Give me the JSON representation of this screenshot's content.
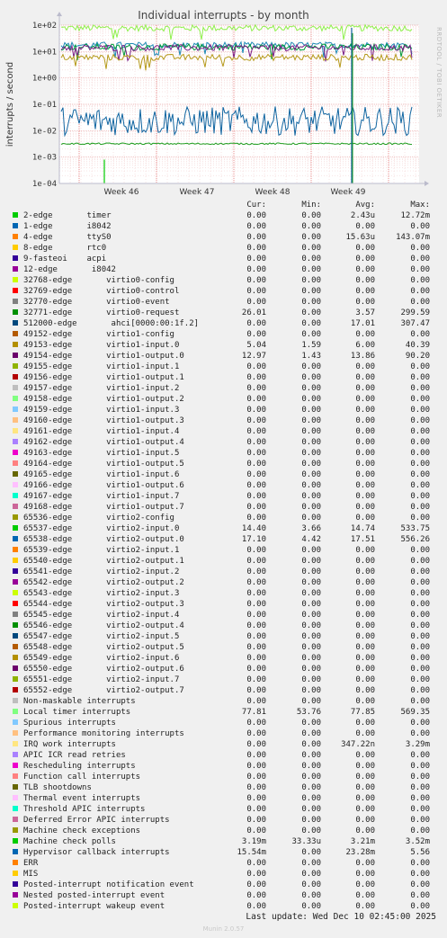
{
  "title": "Individual interrupts - by month",
  "side_label": "RRDTOOL / TOBI OETIKER",
  "footer": "Munin 2.0.57",
  "last_update": "Last update: Wed Dec 10 02:45:00 2025",
  "legend_header": [
    "Cur:",
    "Min:",
    "Avg:",
    "Max:"
  ],
  "chart_data": {
    "type": "line",
    "title": "Individual interrupts - by month",
    "ylabel": "interrupts / second",
    "yscale": "log",
    "ylim": [
      0.0001,
      100
    ],
    "yticks": [
      "1e+02",
      "1e+01",
      "1e+00",
      "1e-01",
      "1e-02",
      "1e-03",
      "1e-04"
    ],
    "x_ticks": [
      "Week 46",
      "Week 47",
      "Week 48",
      "Week 49"
    ],
    "grid": true,
    "legend_placement": "bottom",
    "series": [
      {
        "name": "Local timer interrupts",
        "color": "#8ef04c",
        "level": 77.85
      },
      {
        "name": "65538-edge virtio2-output.0",
        "color": "#1c8ab5",
        "level": 17.51
      },
      {
        "name": "65537-edge virtio2-input.0",
        "color": "#009a3a",
        "level": 14.74
      },
      {
        "name": "49154-edge virtio1-output.0",
        "color": "#7a1f86",
        "level": 13.86
      },
      {
        "name": "49153-edge virtio1-input.0",
        "color": "#b5991a",
        "level": 6.0
      },
      {
        "name": "Hypervisor callback interrupts",
        "color": "#0f64a0",
        "level": 0.0233
      },
      {
        "name": "Machine check polls",
        "color": "#1a9b1a",
        "level": 0.00321
      }
    ],
    "rows": [
      {
        "label": "2-edge       timer",
        "color": "#00cc00",
        "cur": "0.00",
        "min": "0.00",
        "avg": "2.43u",
        "max": "12.72m"
      },
      {
        "label": "1-edge       i8042",
        "color": "#0066b3",
        "cur": "0.00",
        "min": "0.00",
        "avg": "0.00",
        "max": "0.00"
      },
      {
        "label": "4-edge       ttyS0",
        "color": "#ff8000",
        "cur": "0.00",
        "min": "0.00",
        "avg": "15.63u",
        "max": "143.07m"
      },
      {
        "label": "8-edge       rtc0",
        "color": "#ffcc00",
        "cur": "0.00",
        "min": "0.00",
        "avg": "0.00",
        "max": "0.00"
      },
      {
        "label": "9-fasteoi    acpi",
        "color": "#330099",
        "cur": "0.00",
        "min": "0.00",
        "avg": "0.00",
        "max": "0.00"
      },
      {
        "label": "12-edge       i8042",
        "color": "#990099",
        "cur": "0.00",
        "min": "0.00",
        "avg": "0.00",
        "max": "0.00"
      },
      {
        "label": "32768-edge       virtio0-config",
        "color": "#ccff00",
        "cur": "0.00",
        "min": "0.00",
        "avg": "0.00",
        "max": "0.00"
      },
      {
        "label": "32769-edge       virtio0-control",
        "color": "#ff0000",
        "cur": "0.00",
        "min": "0.00",
        "avg": "0.00",
        "max": "0.00"
      },
      {
        "label": "32770-edge       virtio0-event",
        "color": "#808080",
        "cur": "0.00",
        "min": "0.00",
        "avg": "0.00",
        "max": "0.00"
      },
      {
        "label": "32771-edge       virtio0-request",
        "color": "#008f00",
        "cur": "26.01",
        "min": "0.00",
        "avg": "3.57",
        "max": "299.59"
      },
      {
        "label": "512000-edge       ahci[0000:00:1f.2]",
        "color": "#00487d",
        "cur": "0.00",
        "min": "0.00",
        "avg": "17.01",
        "max": "307.47"
      },
      {
        "label": "49152-edge       virtio1-config",
        "color": "#b35a00",
        "cur": "0.00",
        "min": "0.00",
        "avg": "0.00",
        "max": "0.00"
      },
      {
        "label": "49153-edge       virtio1-input.0",
        "color": "#b38f00",
        "cur": "5.04",
        "min": "1.59",
        "avg": "6.00",
        "max": "40.39"
      },
      {
        "label": "49154-edge       virtio1-output.0",
        "color": "#6b006b",
        "cur": "12.97",
        "min": "1.43",
        "avg": "13.86",
        "max": "90.20"
      },
      {
        "label": "49155-edge       virtio1-input.1",
        "color": "#8fb300",
        "cur": "0.00",
        "min": "0.00",
        "avg": "0.00",
        "max": "0.00"
      },
      {
        "label": "49156-edge       virtio1-output.1",
        "color": "#b30000",
        "cur": "0.00",
        "min": "0.00",
        "avg": "0.00",
        "max": "0.00"
      },
      {
        "label": "49157-edge       virtio1-input.2",
        "color": "#bebebe",
        "cur": "0.00",
        "min": "0.00",
        "avg": "0.00",
        "max": "0.00"
      },
      {
        "label": "49158-edge       virtio1-output.2",
        "color": "#80ff80",
        "cur": "0.00",
        "min": "0.00",
        "avg": "0.00",
        "max": "0.00"
      },
      {
        "label": "49159-edge       virtio1-input.3",
        "color": "#80c9ff",
        "cur": "0.00",
        "min": "0.00",
        "avg": "0.00",
        "max": "0.00"
      },
      {
        "label": "49160-edge       virtio1-output.3",
        "color": "#ffc080",
        "cur": "0.00",
        "min": "0.00",
        "avg": "0.00",
        "max": "0.00"
      },
      {
        "label": "49161-edge       virtio1-input.4",
        "color": "#ffe680",
        "cur": "0.00",
        "min": "0.00",
        "avg": "0.00",
        "max": "0.00"
      },
      {
        "label": "49162-edge       virtio1-output.4",
        "color": "#aa80ff",
        "cur": "0.00",
        "min": "0.00",
        "avg": "0.00",
        "max": "0.00"
      },
      {
        "label": "49163-edge       virtio1-input.5",
        "color": "#ee00cc",
        "cur": "0.00",
        "min": "0.00",
        "avg": "0.00",
        "max": "0.00"
      },
      {
        "label": "49164-edge       virtio1-output.5",
        "color": "#ff8080",
        "cur": "0.00",
        "min": "0.00",
        "avg": "0.00",
        "max": "0.00"
      },
      {
        "label": "49165-edge       virtio1-input.6",
        "color": "#666600",
        "cur": "0.00",
        "min": "0.00",
        "avg": "0.00",
        "max": "0.00"
      },
      {
        "label": "49166-edge       virtio1-output.6",
        "color": "#ffbfff",
        "cur": "0.00",
        "min": "0.00",
        "avg": "0.00",
        "max": "0.00"
      },
      {
        "label": "49167-edge       virtio1-input.7",
        "color": "#00ffcc",
        "cur": "0.00",
        "min": "0.00",
        "avg": "0.00",
        "max": "0.00"
      },
      {
        "label": "49168-edge       virtio1-output.7",
        "color": "#cc6699",
        "cur": "0.00",
        "min": "0.00",
        "avg": "0.00",
        "max": "0.00"
      },
      {
        "label": "65536-edge       virtio2-config",
        "color": "#999900",
        "cur": "0.00",
        "min": "0.00",
        "avg": "0.00",
        "max": "0.00"
      },
      {
        "label": "65537-edge       virtio2-input.0",
        "color": "#00cc00",
        "cur": "14.40",
        "min": "3.66",
        "avg": "14.74",
        "max": "533.75"
      },
      {
        "label": "65538-edge       virtio2-output.0",
        "color": "#0066b3",
        "cur": "17.10",
        "min": "4.42",
        "avg": "17.51",
        "max": "556.26"
      },
      {
        "label": "65539-edge       virtio2-input.1",
        "color": "#ff8000",
        "cur": "0.00",
        "min": "0.00",
        "avg": "0.00",
        "max": "0.00"
      },
      {
        "label": "65540-edge       virtio2-output.1",
        "color": "#ffcc00",
        "cur": "0.00",
        "min": "0.00",
        "avg": "0.00",
        "max": "0.00"
      },
      {
        "label": "65541-edge       virtio2-input.2",
        "color": "#330099",
        "cur": "0.00",
        "min": "0.00",
        "avg": "0.00",
        "max": "0.00"
      },
      {
        "label": "65542-edge       virtio2-output.2",
        "color": "#990099",
        "cur": "0.00",
        "min": "0.00",
        "avg": "0.00",
        "max": "0.00"
      },
      {
        "label": "65543-edge       virtio2-input.3",
        "color": "#ccff00",
        "cur": "0.00",
        "min": "0.00",
        "avg": "0.00",
        "max": "0.00"
      },
      {
        "label": "65544-edge       virtio2-output.3",
        "color": "#ff0000",
        "cur": "0.00",
        "min": "0.00",
        "avg": "0.00",
        "max": "0.00"
      },
      {
        "label": "65545-edge       virtio2-input.4",
        "color": "#808080",
        "cur": "0.00",
        "min": "0.00",
        "avg": "0.00",
        "max": "0.00"
      },
      {
        "label": "65546-edge       virtio2-output.4",
        "color": "#008f00",
        "cur": "0.00",
        "min": "0.00",
        "avg": "0.00",
        "max": "0.00"
      },
      {
        "label": "65547-edge       virtio2-input.5",
        "color": "#00487d",
        "cur": "0.00",
        "min": "0.00",
        "avg": "0.00",
        "max": "0.00"
      },
      {
        "label": "65548-edge       virtio2-output.5",
        "color": "#b35a00",
        "cur": "0.00",
        "min": "0.00",
        "avg": "0.00",
        "max": "0.00"
      },
      {
        "label": "65549-edge       virtio2-input.6",
        "color": "#b38f00",
        "cur": "0.00",
        "min": "0.00",
        "avg": "0.00",
        "max": "0.00"
      },
      {
        "label": "65550-edge       virtio2-output.6",
        "color": "#6b006b",
        "cur": "0.00",
        "min": "0.00",
        "avg": "0.00",
        "max": "0.00"
      },
      {
        "label": "65551-edge       virtio2-input.7",
        "color": "#8fb300",
        "cur": "0.00",
        "min": "0.00",
        "avg": "0.00",
        "max": "0.00"
      },
      {
        "label": "65552-edge       virtio2-output.7",
        "color": "#b30000",
        "cur": "0.00",
        "min": "0.00",
        "avg": "0.00",
        "max": "0.00"
      },
      {
        "label": "Non-maskable interrupts",
        "color": "#bebebe",
        "cur": "0.00",
        "min": "0.00",
        "avg": "0.00",
        "max": "0.00"
      },
      {
        "label": "Local timer interrupts",
        "color": "#80ff80",
        "cur": "77.81",
        "min": "53.76",
        "avg": "77.85",
        "max": "569.35"
      },
      {
        "label": "Spurious interrupts",
        "color": "#80c9ff",
        "cur": "0.00",
        "min": "0.00",
        "avg": "0.00",
        "max": "0.00"
      },
      {
        "label": "Performance monitoring interrupts",
        "color": "#ffc080",
        "cur": "0.00",
        "min": "0.00",
        "avg": "0.00",
        "max": "0.00"
      },
      {
        "label": "IRQ work interrupts",
        "color": "#ffe680",
        "cur": "0.00",
        "min": "0.00",
        "avg": "347.22n",
        "max": "3.29m"
      },
      {
        "label": "APIC ICR read retries",
        "color": "#aa80ff",
        "cur": "0.00",
        "min": "0.00",
        "avg": "0.00",
        "max": "0.00"
      },
      {
        "label": "Rescheduling interrupts",
        "color": "#ee00cc",
        "cur": "0.00",
        "min": "0.00",
        "avg": "0.00",
        "max": "0.00"
      },
      {
        "label": "Function call interrupts",
        "color": "#ff8080",
        "cur": "0.00",
        "min": "0.00",
        "avg": "0.00",
        "max": "0.00"
      },
      {
        "label": "TLB shootdowns",
        "color": "#666600",
        "cur": "0.00",
        "min": "0.00",
        "avg": "0.00",
        "max": "0.00"
      },
      {
        "label": "Thermal event interrupts",
        "color": "#ffbfff",
        "cur": "0.00",
        "min": "0.00",
        "avg": "0.00",
        "max": "0.00"
      },
      {
        "label": "Threshold APIC interrupts",
        "color": "#00ffcc",
        "cur": "0.00",
        "min": "0.00",
        "avg": "0.00",
        "max": "0.00"
      },
      {
        "label": "Deferred Error APIC interrupts",
        "color": "#cc6699",
        "cur": "0.00",
        "min": "0.00",
        "avg": "0.00",
        "max": "0.00"
      },
      {
        "label": "Machine check exceptions",
        "color": "#999900",
        "cur": "0.00",
        "min": "0.00",
        "avg": "0.00",
        "max": "0.00"
      },
      {
        "label": "Machine check polls",
        "color": "#00cc00",
        "cur": "3.19m",
        "min": "33.33u",
        "avg": "3.21m",
        "max": "3.52m"
      },
      {
        "label": "Hypervisor callback interrupts",
        "color": "#0066b3",
        "cur": "15.54m",
        "min": "0.00",
        "avg": "23.28m",
        "max": "5.56"
      },
      {
        "label": "ERR",
        "color": "#ff8000",
        "cur": "0.00",
        "min": "0.00",
        "avg": "0.00",
        "max": "0.00"
      },
      {
        "label": "MIS",
        "color": "#ffcc00",
        "cur": "0.00",
        "min": "0.00",
        "avg": "0.00",
        "max": "0.00"
      },
      {
        "label": "Posted-interrupt notification event",
        "color": "#330099",
        "cur": "0.00",
        "min": "0.00",
        "avg": "0.00",
        "max": "0.00"
      },
      {
        "label": "Nested posted-interrupt event",
        "color": "#990099",
        "cur": "0.00",
        "min": "0.00",
        "avg": "0.00",
        "max": "0.00"
      },
      {
        "label": "Posted-interrupt wakeup event",
        "color": "#ccff00",
        "cur": "0.00",
        "min": "0.00",
        "avg": "0.00",
        "max": "0.00"
      }
    ]
  }
}
